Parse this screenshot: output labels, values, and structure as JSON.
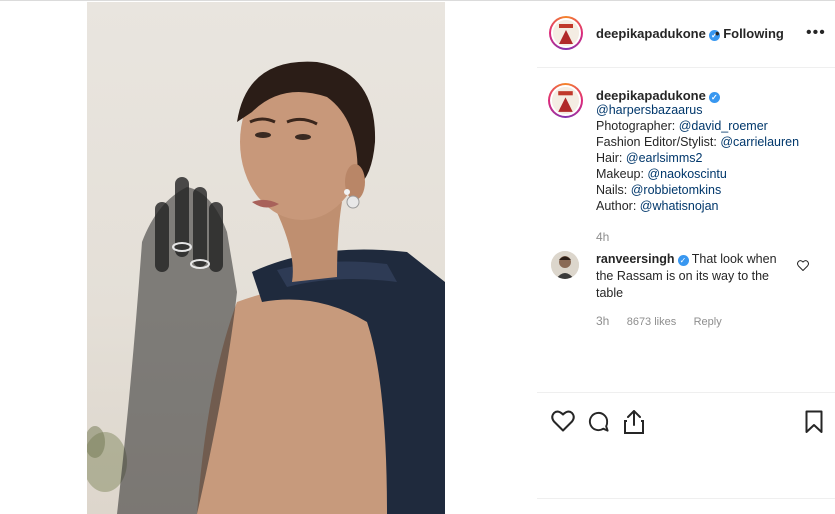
{
  "post": {
    "author": "deepikapadukone",
    "follow_sep": "•",
    "follow_status": "Following",
    "more_label": "•••"
  },
  "caption": {
    "username": "deepikapadukone",
    "lines": [
      {
        "prefix": "",
        "link": "@harpersbazaarus"
      },
      {
        "prefix": "Photographer: ",
        "link": "@david_roemer"
      },
      {
        "prefix": "Fashion Editor/Stylist: ",
        "link": "@carrielauren"
      },
      {
        "prefix": "Hair: ",
        "link": "@earlsimms2"
      },
      {
        "prefix": "Makeup: ",
        "link": "@naokoscintu"
      },
      {
        "prefix": "Nails: ",
        "link": "@robbietomkins"
      },
      {
        "prefix": "Author: ",
        "link": "@whatisnojan"
      }
    ],
    "time": "4h"
  },
  "comment": {
    "username": "ranveersingh",
    "text": "That look when the Rassam is on its way to the table",
    "time": "3h",
    "likes": "8673 likes",
    "reply": "Reply"
  },
  "actions": {
    "like_icon": "heart-icon",
    "comment_icon": "comment-icon",
    "share_icon": "share-icon",
    "save_icon": "bookmark-icon"
  },
  "colors": {
    "verified": "#3897f0",
    "link": "#00376b",
    "meta": "#8e8e8e",
    "dress": "#1f2a3d"
  }
}
